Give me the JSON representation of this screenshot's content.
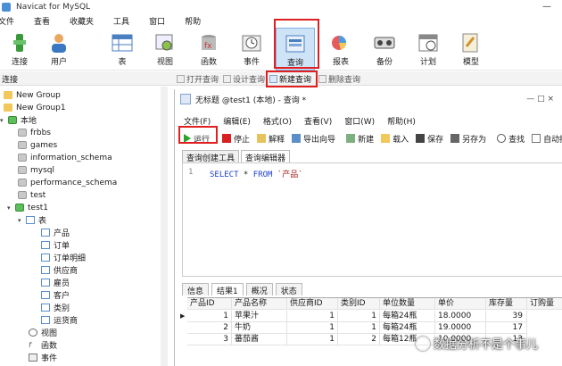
{
  "window": {
    "title": "Navicat for MySQL",
    "controls": "—"
  },
  "menubar": [
    "文件",
    "查看",
    "收藏夹",
    "工具",
    "窗口",
    "帮助"
  ],
  "toolbar": [
    {
      "label": "连接",
      "icon": "connection-icon"
    },
    {
      "label": "用户",
      "icon": "user-icon"
    },
    {
      "label": "表",
      "icon": "table-icon"
    },
    {
      "label": "视图",
      "icon": "view-icon"
    },
    {
      "label": "函数",
      "icon": "function-icon"
    },
    {
      "label": "事件",
      "icon": "event-icon"
    },
    {
      "label": "查询",
      "icon": "query-icon"
    },
    {
      "label": "报表",
      "icon": "report-icon"
    },
    {
      "label": "备份",
      "icon": "backup-icon"
    },
    {
      "label": "计划",
      "icon": "schedule-icon"
    },
    {
      "label": "模型",
      "icon": "model-icon"
    }
  ],
  "subbar": {
    "connection_label": "连接",
    "actions": [
      "打开查询",
      "设计查询",
      "新建查询",
      "删除查询"
    ]
  },
  "tree": {
    "groups": [
      "New Group",
      "New Group1"
    ],
    "local": "本地",
    "databases": [
      "frbbs",
      "games",
      "information_schema",
      "mysql",
      "performance_schema",
      "test"
    ],
    "open_db": "test1",
    "tables_label": "表",
    "tables": [
      "产品",
      "订单",
      "订单明细",
      "供应商",
      "雇员",
      "客户",
      "类别",
      "运货商"
    ],
    "views_label": "视图",
    "functions_label": "函数",
    "events_label": "事件"
  },
  "query_window": {
    "title": "无标题 @test1 (本地) - 查询 *",
    "controls": "—  □  ×",
    "menu": [
      "文件(F)",
      "编辑(E)",
      "格式(O)",
      "查看(V)",
      "窗口(W)",
      "帮助(H)"
    ],
    "tools": [
      "运行",
      "停止",
      "解释",
      "导出向导",
      "新建",
      "载入",
      "保存",
      "另存为",
      "查找",
      "自动换行"
    ],
    "tabs": [
      "查询创建工具",
      "查询编辑器"
    ],
    "sql_line": "1",
    "sql": {
      "select": "SELECT",
      "star": " * ",
      "from": "FROM",
      "table": " `产品`"
    },
    "result_tabs": [
      "信息",
      "结果1",
      "概况",
      "状态"
    ]
  },
  "grid": {
    "columns": [
      "产品ID",
      "产品名称",
      "供应商ID",
      "类别ID",
      "单位数量",
      "单价",
      "库存量",
      "订购量"
    ],
    "rows": [
      [
        "1",
        "苹果汁",
        "1",
        "1",
        "每箱24瓶",
        "18.0000",
        "39"
      ],
      [
        "2",
        "牛奶",
        "1",
        "1",
        "每箱24瓶",
        "19.0000",
        "17"
      ],
      [
        "3",
        "蕃茄酱",
        "1",
        "2",
        "每箱12瓶",
        "10.0000",
        "13"
      ]
    ]
  },
  "watermark": "数据分析不是个事儿",
  "colors": {
    "accent": "#cfe3f7",
    "annotation": "#e02020",
    "keyword": "#1a3fd1"
  }
}
